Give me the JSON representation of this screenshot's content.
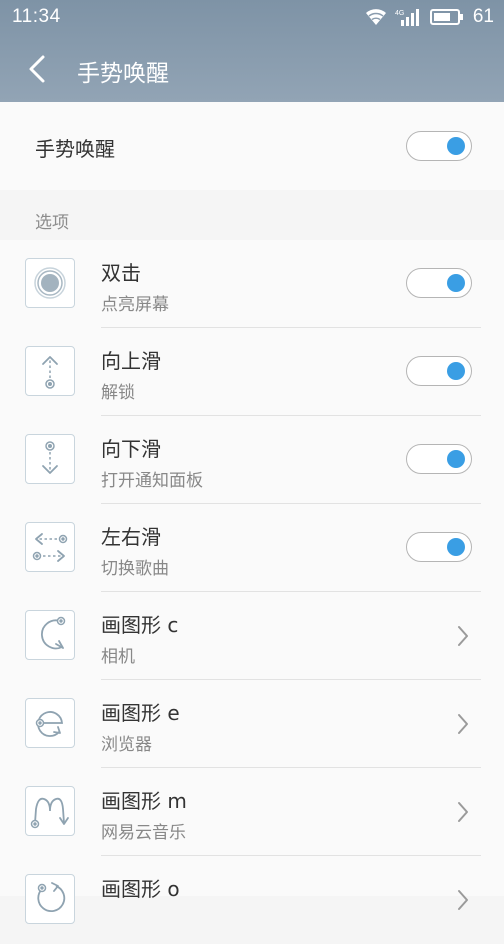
{
  "status_bar": {
    "time": "11:34",
    "network": "4G",
    "battery": "61"
  },
  "header": {
    "title": "手势唤醒"
  },
  "main_toggle": {
    "label": "手势唤醒",
    "enabled": true
  },
  "section": {
    "label": "选项"
  },
  "gestures": [
    {
      "title": "双击",
      "subtitle": "点亮屏幕",
      "control": "toggle",
      "enabled": true,
      "icon": "double-tap-icon"
    },
    {
      "title": "向上滑",
      "subtitle": "解锁",
      "control": "toggle",
      "enabled": true,
      "icon": "swipe-up-icon"
    },
    {
      "title": "向下滑",
      "subtitle": "打开通知面板",
      "control": "toggle",
      "enabled": true,
      "icon": "swipe-down-icon"
    },
    {
      "title": "左右滑",
      "subtitle": "切换歌曲",
      "control": "toggle",
      "enabled": true,
      "icon": "swipe-left-right-icon"
    },
    {
      "title": "画图形 c",
      "subtitle": "相机",
      "control": "chevron",
      "icon": "draw-c-icon"
    },
    {
      "title": "画图形 e",
      "subtitle": "浏览器",
      "control": "chevron",
      "icon": "draw-e-icon"
    },
    {
      "title": "画图形 m",
      "subtitle": "网易云音乐",
      "control": "chevron",
      "icon": "draw-m-icon"
    },
    {
      "title": "画图形 o",
      "subtitle": "",
      "control": "chevron",
      "icon": "draw-o-icon"
    }
  ],
  "colors": {
    "header": "#8a9cae",
    "accent": "#3a9ee4"
  }
}
